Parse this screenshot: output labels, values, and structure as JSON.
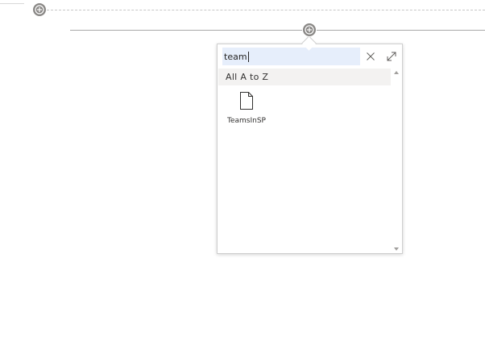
{
  "page": {
    "section_add_label": "",
    "webpart_add_label": ""
  },
  "toolbox": {
    "search": {
      "value": "team",
      "placeholder": ""
    },
    "close_icon": "close-icon",
    "expand_icon": "expand-icon",
    "section_title": "All A to Z",
    "items": [
      {
        "label": "TeamsInSP",
        "icon": "document-icon"
      }
    ]
  },
  "colors": {
    "add_button": "#8a8886",
    "search_bg": "#e6eefb",
    "section_header_bg": "#f3f2f1",
    "divider": "#a8a8a8"
  }
}
